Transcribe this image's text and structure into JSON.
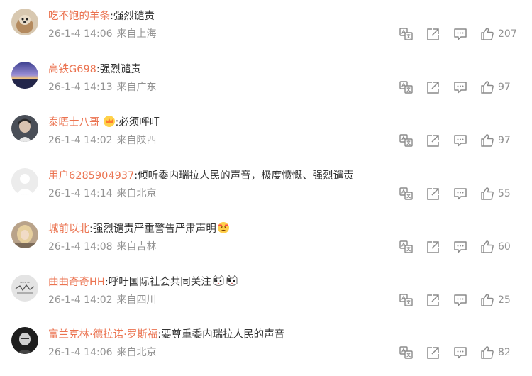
{
  "comments": [
    {
      "username": "吃不饱的羊条",
      "text": "强烈谴责",
      "time": "26-1-4 14:06",
      "location": "来自上海",
      "likes": "207",
      "avatar": "dog-photo",
      "avatar_color": "#c9b49a",
      "emojis": []
    },
    {
      "username": "高铁G698",
      "text": "强烈谴责",
      "time": "26-1-4 14:13",
      "location": "来自广东",
      "likes": "97",
      "avatar": "sunset-sky",
      "avatar_color": "#6a6fb8",
      "emojis": []
    },
    {
      "username": "泰晤士八哥",
      "text": "必须呼吁",
      "time": "26-1-4 14:02",
      "location": "来自陕西",
      "likes": "97",
      "avatar": "portrait-photo",
      "avatar_color": "#3a3f48",
      "emojis": [],
      "badge": "crown-badge"
    },
    {
      "username": "用户6285904937",
      "text": "倾听委内瑞拉人民的声音，极度愤慨、强烈谴责",
      "time": "26-1-4 14:14",
      "location": "来自北京",
      "likes": "55",
      "avatar": "default-avatar",
      "avatar_color": "#e6e6e6",
      "emojis": []
    },
    {
      "username": "城前以北",
      "text": "强烈谴责严重警告严肃声明",
      "time": "26-1-4 14:08",
      "location": "来自吉林",
      "likes": "60",
      "avatar": "blonde-portrait",
      "avatar_color": "#c8a678",
      "emojis": [
        "angry-face-emoji"
      ]
    },
    {
      "username": "曲曲奇奇HH",
      "text": "呼吁国际社会共同关注",
      "time": "26-1-4 14:02",
      "location": "来自四川",
      "likes": "25",
      "avatar": "sketch-image",
      "avatar_color": "#d9d9d9",
      "emojis": [
        "cat-emoji",
        "cat-emoji"
      ]
    },
    {
      "username": "富兰克林·德拉诺·罗斯福",
      "text": "要尊重委内瑞拉人民的声音",
      "time": "26-1-4 14:06",
      "location": "来自北京",
      "likes": "82",
      "avatar": "bw-portrait",
      "avatar_color": "#2e2e2e",
      "emojis": []
    }
  ],
  "actions": [
    "translate-icon",
    "share-icon",
    "comment-icon",
    "like-icon"
  ],
  "colors": {
    "username": "#eb7350",
    "text": "#333333",
    "meta": "#939393",
    "icon": "#8a8a8a"
  }
}
